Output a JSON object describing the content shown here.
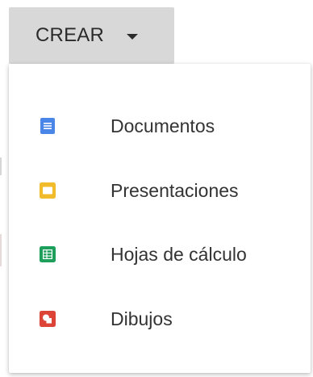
{
  "create_button": {
    "label": "CREAR",
    "icon": "caret-down-icon"
  },
  "menu": {
    "items": [
      {
        "label": "Documentos",
        "icon": "docs-icon",
        "color": "#4a86e8"
      },
      {
        "label": "Presentaciones",
        "icon": "slides-icon",
        "color": "#f2bb2c"
      },
      {
        "label": "Hojas de cálculo",
        "icon": "sheets-icon",
        "color": "#1e9e5b"
      },
      {
        "label": "Dibujos",
        "icon": "drawings-icon",
        "color": "#db4437"
      }
    ]
  }
}
